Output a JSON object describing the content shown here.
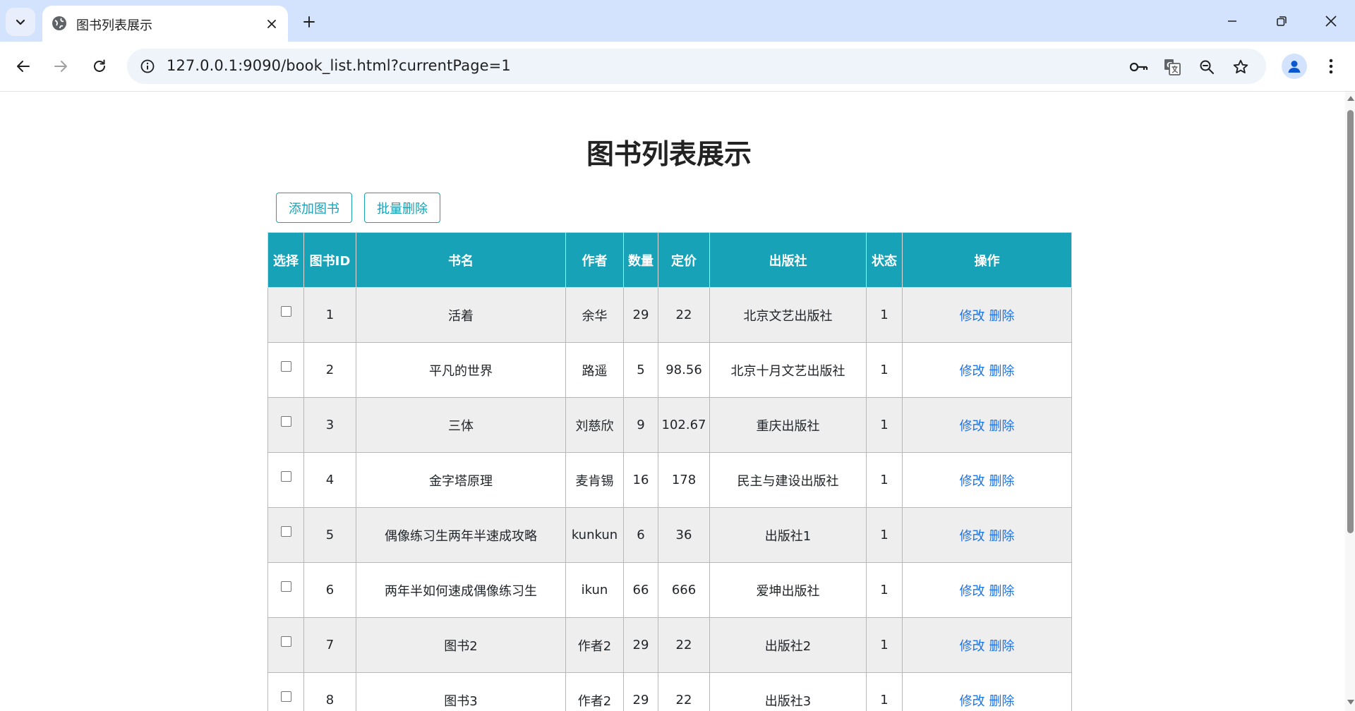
{
  "browser": {
    "tab_title": "图书列表展示",
    "url": "127.0.0.1:9090/book_list.html?currentPage=1"
  },
  "page": {
    "title": "图书列表展示",
    "add_button": "添加图书",
    "batch_delete_button": "批量删除"
  },
  "table": {
    "headers": {
      "select": "选择",
      "id": "图书ID",
      "name": "书名",
      "author": "作者",
      "count": "数量",
      "price": "定价",
      "publisher": "出版社",
      "status": "状态",
      "ops": "操作"
    },
    "rows": [
      {
        "id": "1",
        "name": "活着",
        "author": "余华",
        "count": "29",
        "price": "22",
        "publisher": "北京文艺出版社",
        "status": "1",
        "edit": "修改",
        "delete": "删除"
      },
      {
        "id": "2",
        "name": "平凡的世界",
        "author": "路遥",
        "count": "5",
        "price": "98.56",
        "publisher": "北京十月文艺出版社",
        "status": "1",
        "edit": "修改",
        "delete": "删除"
      },
      {
        "id": "3",
        "name": "三体",
        "author": "刘慈欣",
        "count": "9",
        "price": "102.67",
        "publisher": "重庆出版社",
        "status": "1",
        "edit": "修改",
        "delete": "删除"
      },
      {
        "id": "4",
        "name": "金字塔原理",
        "author": "麦肯锡",
        "count": "16",
        "price": "178",
        "publisher": "民主与建设出版社",
        "status": "1",
        "edit": "修改",
        "delete": "删除"
      },
      {
        "id": "5",
        "name": "偶像练习生两年半速成攻略",
        "author": "kunkun",
        "count": "6",
        "price": "36",
        "publisher": "出版社1",
        "status": "1",
        "edit": "修改",
        "delete": "删除"
      },
      {
        "id": "6",
        "name": "两年半如何速成偶像练习生",
        "author": "ikun",
        "count": "66",
        "price": "666",
        "publisher": "爱坤出版社",
        "status": "1",
        "edit": "修改",
        "delete": "删除"
      },
      {
        "id": "7",
        "name": "图书2",
        "author": "作者2",
        "count": "29",
        "price": "22",
        "publisher": "出版社2",
        "status": "1",
        "edit": "修改",
        "delete": "删除"
      },
      {
        "id": "8",
        "name": "图书3",
        "author": "作者2",
        "count": "29",
        "price": "22",
        "publisher": "出版社3",
        "status": "1",
        "edit": "修改",
        "delete": "删除"
      }
    ]
  },
  "colors": {
    "accent": "#17a2b8",
    "link": "#1a73e8",
    "tabbar": "#d3e3fd"
  },
  "icons": [
    "tab-list-chevron-icon",
    "globe-icon",
    "close-icon",
    "plus-icon",
    "minimize-icon",
    "restore-icon",
    "window-close-icon",
    "back-arrow-icon",
    "forward-arrow-icon",
    "reload-icon",
    "site-info-icon",
    "password-key-icon",
    "translate-icon",
    "zoom-icon",
    "bookmark-star-icon",
    "profile-icon",
    "kebab-menu-icon"
  ]
}
